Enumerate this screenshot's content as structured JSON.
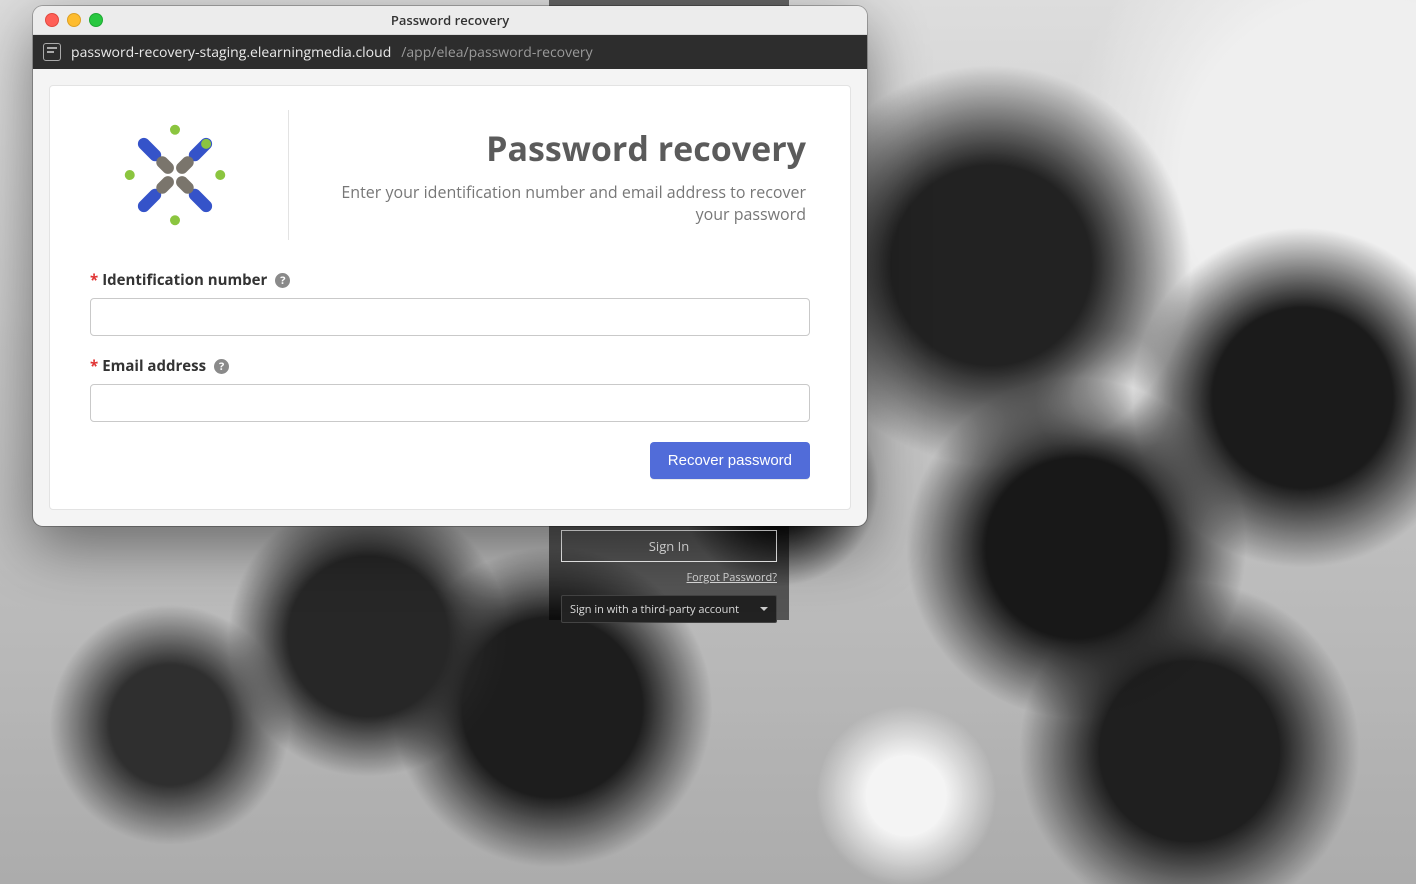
{
  "window": {
    "title": "Password recovery",
    "url_host": "password-recovery-staging.elearningmedia.cloud",
    "url_path": "/app/elea/password-recovery"
  },
  "header": {
    "title": "Password recovery",
    "subtitle": "Enter your identification number and email address to recover your password"
  },
  "form": {
    "required_mark": "*",
    "id_label": "Identification number",
    "id_value": "",
    "email_label": "Email address",
    "email_value": "",
    "help_glyph": "?",
    "submit_label": "Recover password"
  },
  "background_login": {
    "signin_label": "Sign In",
    "forgot_label": "Forgot Password?",
    "third_party_label": "Sign in with a third-party account"
  }
}
